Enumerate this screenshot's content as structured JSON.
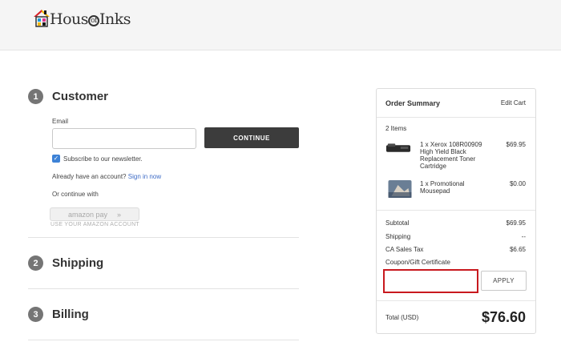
{
  "brand": {
    "logo_text_pre": "Hous",
    "logo_text_o": "of",
    "logo_text_post": "Inks",
    "colors": {
      "roof_left": "#d8232a",
      "roof_right": "#f2b705",
      "window_a": "#1d9bd7",
      "window_b": "#e0338a",
      "window_c": "#f2b705",
      "window_d": "#1a1a1a"
    }
  },
  "customer": {
    "step_number": "1",
    "title": "Customer",
    "email_label": "Email",
    "email_value": "",
    "continue_label": "CONTINUE",
    "newsletter_label": "Subscribe to our newsletter.",
    "newsletter_checked": true,
    "have_account_text": "Already have an account?",
    "sign_in_link": "Sign in now",
    "or_continue": "Or continue with",
    "amazon_pay_label": "amazon pay",
    "amazon_pay_arrows": "»",
    "amazon_sub": "USE YOUR AMAZON ACCOUNT"
  },
  "shipping": {
    "step_number": "2",
    "title": "Shipping"
  },
  "billing": {
    "step_number": "3",
    "title": "Billing"
  },
  "summary": {
    "title": "Order Summary",
    "edit_cart": "Edit Cart",
    "items_count": "2 Items",
    "items": [
      {
        "name": "1 x Xerox 108R00909 High Yield Black Replacement Toner Cartridge",
        "price": "$69.95",
        "icon": "toner-cartridge-image"
      },
      {
        "name": "1 x Promotional Mousepad",
        "price": "$0.00",
        "icon": "mousepad-image"
      }
    ],
    "subtotal_label": "Subtotal",
    "subtotal_value": "$69.95",
    "shipping_label": "Shipping",
    "shipping_value": "--",
    "tax_label": "CA Sales Tax",
    "tax_value": "$6.65",
    "coupon_link": "Coupon/Gift Certificate",
    "coupon_value": "",
    "apply_label": "APPLY",
    "total_label": "Total (USD)",
    "total_value": "$76.60"
  },
  "colors": {
    "accent_link": "#3d6bc6",
    "checkbox": "#3d82d6",
    "button_dark": "#3c3c3c",
    "highlight_red": "#c8191e"
  }
}
